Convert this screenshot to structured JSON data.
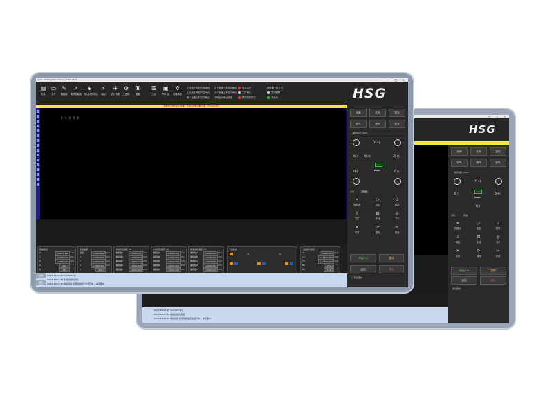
{
  "window_title": "HSG X1000 [Demo Mode] (7.22.18).0",
  "window_controls": "— □ ×",
  "logo": "HSG",
  "warning": "当前为DEMO演示版本，仅用于观看功能介绍，不可实际加工",
  "canvas_coord": "0 X 0 X 0",
  "toolbar": [
    {
      "icon": "file-icon",
      "glyph": "▤",
      "label": "文件"
    },
    {
      "icon": "open-icon",
      "glyph": "▭",
      "label": "打开"
    },
    {
      "icon": "draw-icon",
      "glyph": "✎",
      "label": "画图库"
    },
    {
      "icon": "arrow-icon",
      "glyph": "↗",
      "label": "电视剪模板"
    },
    {
      "icon": "target-icon",
      "glyph": "⊕",
      "label": "标注切割中心"
    },
    {
      "icon": "run-icon",
      "glyph": "⚡",
      "label": "模拟"
    },
    {
      "icon": "laser-icon",
      "glyph": "⁜",
      "label": "引入设置"
    },
    {
      "icon": "gear-icon",
      "glyph": "⚙",
      "label": "三坐标"
    },
    {
      "icon": "hat-icon",
      "glyph": "♜",
      "label": "数据"
    },
    {
      "icon": "table-icon",
      "glyph": "☰",
      "label": "工具"
    },
    {
      "icon": "box-icon",
      "glyph": "▣",
      "label": "Pro门控"
    },
    {
      "icon": "settings-icon",
      "glyph": "✲",
      "label": "全局参数"
    }
  ],
  "options": {
    "col1": [
      "上料加工开启开启/确认",
      "上料加工开启开启/确认",
      "两个轴周上料自动确认"
    ],
    "col2": [
      "共个轮面上料自动确认",
      "共个轮面上料自动确认",
      "下料自动确认开启"
    ],
    "col3": [
      "暂停激光",
      "工件确认",
      "预设模拟模式"
    ],
    "col4": [
      "跟踪器上料方式",
      "关闭跟踪",
      "不启动"
    ]
  },
  "side": {
    "row1": [
      "光阀",
      "红光",
      "激光"
    ],
    "row2": [
      "吹气",
      "氧气",
      "氮气"
    ],
    "speed_label": "相机速度 100%",
    "jog": {
      "yplus": "Y(+)",
      "xminus": "X(-)",
      "xplus": "X(+)",
      "yminus": "Y(-)",
      "zplus": "Z(+)",
      "zminus": "Z(-)"
    },
    "low": "LOW",
    "high": "HIGH",
    "step_label": "点动",
    "step_value": "步进",
    "row3": [
      "回原点",
      "空走",
      "回零"
    ],
    "row4": [
      "寻边",
      "手动",
      "寻中"
    ],
    "row5": [
      "清零",
      "旋转",
      "切割"
    ],
    "start": "开始(F1)",
    "pause": "暂停",
    "stop_label": "停止",
    "return": "返回",
    "process_mode": "调试模式"
  },
  "bottom": {
    "panel1": {
      "title": "机械坐标",
      "rows": [
        [
          "X",
          "+0223.456",
          "mm"
        ],
        [
          "Y",
          "+0000.000",
          "mm"
        ],
        [
          "Z",
          "+0000.000",
          "mm"
        ],
        [
          "A",
          "+000.2",
          "°"
        ],
        [
          "B",
          "+180.1",
          "°"
        ]
      ]
    },
    "panel2": {
      "title": "切割速度",
      "rows": [
        [
          "速度",
          "+0000.000",
          "mm/s"
        ],
        [
          "X",
          "+0000.000",
          "mm"
        ],
        [
          "Y",
          "+0000.000",
          "mm"
        ],
        [
          "Z",
          "+0000.000",
          "mm"
        ],
        [
          "A",
          "+000.0",
          "°"
        ]
      ]
    },
    "panel3": {
      "title": "参考参数设定 1#",
      "rows": [
        [
          "偏移轴A",
          "+0000.000",
          "mm"
        ],
        [
          "偏移轴B",
          "+0000.000",
          "mm"
        ],
        [
          "偏移轴C",
          "+0000.000",
          "mm"
        ],
        [
          "偏移轴D",
          "+0000.000",
          "mm"
        ],
        [
          "偏移轴E",
          "+0000.000",
          "mm"
        ]
      ]
    },
    "panel4": {
      "title": "参考参数设定 2#",
      "rows": [
        [
          "偏移轴A",
          "+0000.000",
          "mm"
        ],
        [
          "偏移轴B",
          "+0000.000",
          "mm"
        ],
        [
          "偏移轴C",
          "+0000.000",
          "mm"
        ],
        [
          "偏移轴D",
          "+0000.000",
          "mm"
        ],
        [
          "偏移轴E",
          "+0000.000",
          "mm"
        ]
      ]
    },
    "panel5": {
      "title": "参考参数设定 3#",
      "rows": [
        [
          "偏移轴A",
          "+0000.000",
          "mm"
        ],
        [
          "偏移轴B",
          "+0000.000",
          "mm"
        ],
        [
          "偏移轴C",
          "+0000.000",
          "mm"
        ],
        [
          "偏移轴D",
          "+0000.000",
          "mm"
        ],
        [
          "偏移轴E",
          "+0000.000",
          "mm"
        ]
      ]
    },
    "panel6": {
      "title": "卡盘状态",
      "y1": "Y1",
      "y2": "Y2"
    },
    "panel7": {
      "title": "卡盘绝对坐标",
      "rows": [
        [
          "Y1",
          "+0300.000",
          "mm"
        ],
        [
          "Y2",
          "+13940.000",
          "mm"
        ],
        [
          "Y3",
          "+13550.000",
          "mm"
        ],
        [
          "B1",
          "+180.3",
          "°"
        ],
        [
          "B2",
          "+180.1",
          "°"
        ]
      ]
    }
  },
  "log": {
    "tab1": "日志",
    "tab2": "报警",
    "lines": [
      "09/26 16:07:48 ComSSP.4pc",
      "09/26 16:07:48 系统初始化完成：",
      "09/26 16:07:48 启动系统 检测到启动正在运行中 ，本功能中"
    ]
  },
  "colors": {
    "warning": "#f5e642",
    "canvas": "#000000",
    "panel": "#2c2c2c",
    "log": "#c8d8f0",
    "accent_green": "#31c231",
    "accent_orange": "#e48a1a"
  }
}
